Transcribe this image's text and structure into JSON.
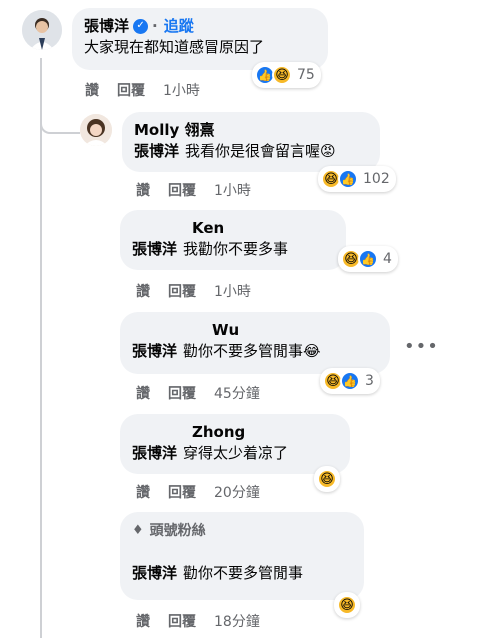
{
  "main_comment": {
    "author": "張博洋",
    "follow_label": "追蹤",
    "text": "大家現在都知道感冒原因了",
    "like_label": "讚",
    "reply_label": "回覆",
    "time": "1小時",
    "reaction_count": "75"
  },
  "replies": [
    {
      "author": "Molly 翎熹",
      "mention": "張博洋",
      "text": "我看你是很會留言喔",
      "like_label": "讚",
      "reply_label": "回覆",
      "time": "1小時",
      "reaction_count": "102"
    },
    {
      "author": "Ken",
      "mention": "張博洋",
      "text": "我勸你不要多事",
      "like_label": "讚",
      "reply_label": "回覆",
      "time": "1小時",
      "reaction_count": "4"
    },
    {
      "author": "Wu",
      "mention": "張博洋",
      "text": "勸你不要多管閒事",
      "like_label": "讚",
      "reply_label": "回覆",
      "time": "45分鐘",
      "reaction_count": "3"
    },
    {
      "author": "Zhong",
      "mention": "張博洋",
      "text": "穿得太少着凉了",
      "like_label": "讚",
      "reply_label": "回覆",
      "time": "20分鐘"
    },
    {
      "badge": "頭號粉絲",
      "mention": "張博洋",
      "text": "勸你不要多管閒事",
      "like_label": "讚",
      "reply_label": "回覆",
      "time": "18分鐘"
    }
  ],
  "colors": {
    "bubble": "#f0f2f5",
    "link_blue": "#1877f2",
    "meta_gray": "#65676b"
  },
  "icons": {
    "verified": "verified-badge-icon",
    "badge": "diamond-icon",
    "more": "more-options-icon"
  }
}
